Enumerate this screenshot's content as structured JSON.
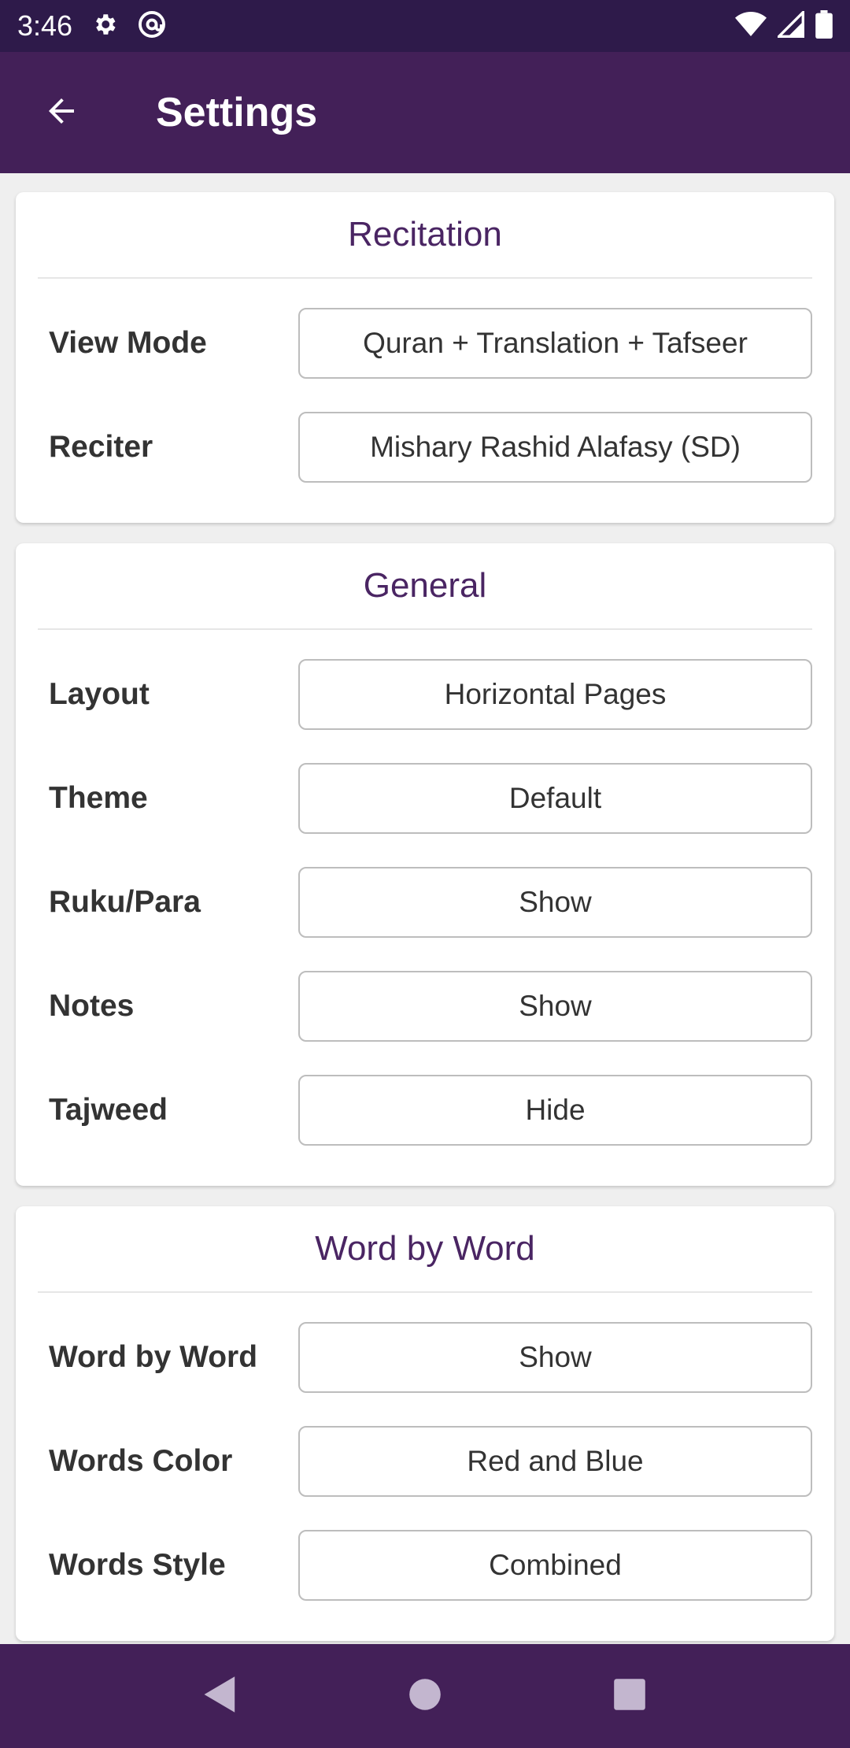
{
  "status_bar": {
    "time": "3:46"
  },
  "app_bar": {
    "title": "Settings"
  },
  "sections": {
    "recitation": {
      "title": "Recitation",
      "rows": [
        {
          "label": "View Mode",
          "value": "Quran + Translation + Tafseer"
        },
        {
          "label": "Reciter",
          "value": "Mishary Rashid Alafasy (SD)"
        }
      ]
    },
    "general": {
      "title": "General",
      "rows": [
        {
          "label": "Layout",
          "value": "Horizontal Pages"
        },
        {
          "label": "Theme",
          "value": "Default"
        },
        {
          "label": "Ruku/Para",
          "value": "Show"
        },
        {
          "label": "Notes",
          "value": "Show"
        },
        {
          "label": "Tajweed",
          "value": "Hide"
        }
      ]
    },
    "word_by_word": {
      "title": "Word by Word",
      "rows": [
        {
          "label": "Word by Word",
          "value": "Show"
        },
        {
          "label": "Words Color",
          "value": "Red and Blue"
        },
        {
          "label": "Words Style",
          "value": "Combined"
        }
      ]
    }
  },
  "icons": {
    "status": [
      "gear-icon",
      "at-sign-icon",
      "wifi-icon",
      "signal-icon",
      "battery-icon"
    ],
    "app_bar": [
      "back-arrow-icon"
    ],
    "nav": [
      "nav-back-icon",
      "nav-home-icon",
      "nav-recents-icon"
    ]
  },
  "colors": {
    "status_bar": "#2e1a4a",
    "app_bar": "#432058",
    "section_title": "#4a2563",
    "background": "#efefef"
  }
}
